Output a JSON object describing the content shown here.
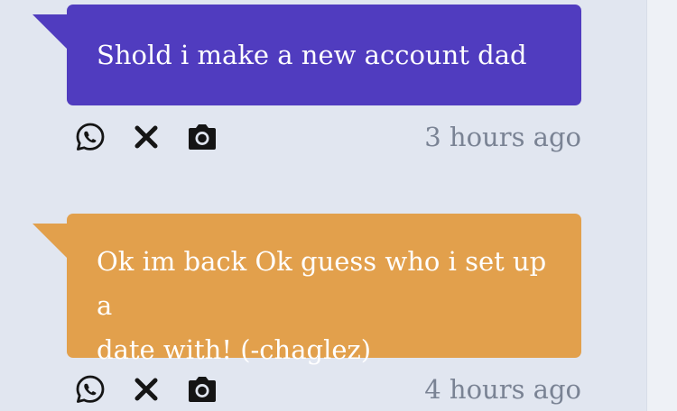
{
  "messages": [
    {
      "text": "Shold i make a new account dad",
      "color": "#503cbf",
      "timestamp": "3 hours ago",
      "icons": [
        "whatsapp-icon",
        "close-icon",
        "camera-icon"
      ]
    },
    {
      "text_line1": "Ok im back Ok guess who i set up a",
      "text_line2": "date with! (-chaglez)",
      "color": "#e2a04c",
      "timestamp": "4 hours ago",
      "icons": [
        "whatsapp-icon",
        "close-icon",
        "camera-icon"
      ]
    }
  ]
}
